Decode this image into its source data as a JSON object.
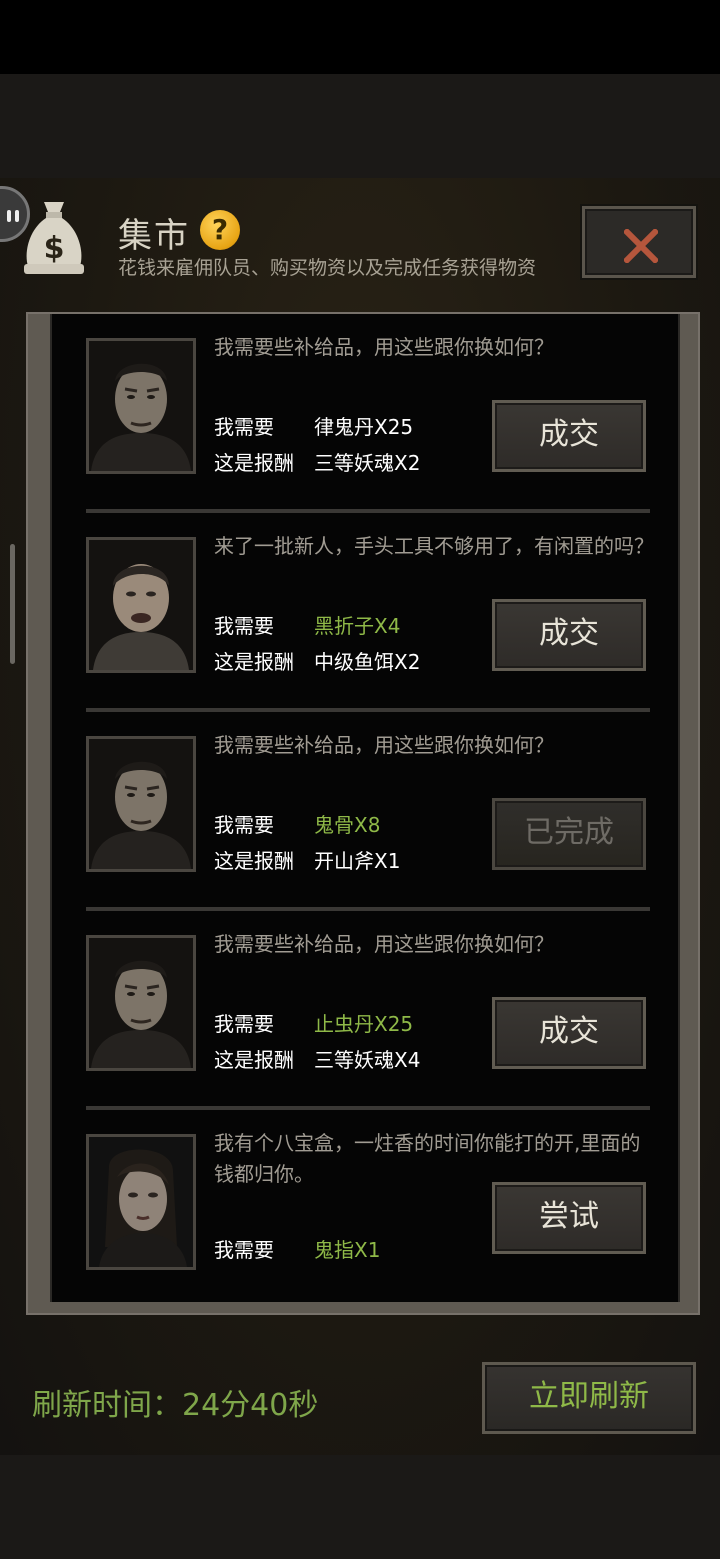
{
  "header": {
    "title": "集市",
    "help_symbol": "?",
    "subtitle": "花钱来雇佣队员、购买物资以及完成任务获得物资"
  },
  "colors": {
    "accent_green": "#8fb948",
    "panel_bg": "#1d1911",
    "close_x": "#b5563c"
  },
  "icons": {
    "header": "money-bag-icon",
    "close": "close-icon",
    "help": "help-icon"
  },
  "trades": [
    {
      "portrait": "man-1",
      "dialog": "我需要些补给品，用这些跟你换如何？",
      "need_label": "我需要",
      "need_item": "律鬼丹X25",
      "need_green": false,
      "reward_label": "这是报酬",
      "reward_item": "三等妖魂X2",
      "button": "成交",
      "completed": false
    },
    {
      "portrait": "man-2",
      "dialog": "来了一批新人，手头工具不够用了，有闲置的吗？",
      "need_label": "我需要",
      "need_item": "黑折子X4",
      "need_green": true,
      "reward_label": "这是报酬",
      "reward_item": "中级鱼饵X2",
      "button": "成交",
      "completed": false
    },
    {
      "portrait": "man-1",
      "dialog": "我需要些补给品，用这些跟你换如何？",
      "need_label": "我需要",
      "need_item": "鬼骨X8",
      "need_green": true,
      "reward_label": "这是报酬",
      "reward_item": "开山斧X1",
      "button": "已完成",
      "completed": true
    },
    {
      "portrait": "man-1",
      "dialog": "我需要些补给品，用这些跟你换如何？",
      "need_label": "我需要",
      "need_item": "止虫丹X25",
      "need_green": true,
      "reward_label": "这是报酬",
      "reward_item": "三等妖魂X4",
      "button": "成交",
      "completed": false
    },
    {
      "portrait": "woman-1",
      "dialog": "我有个八宝盒，一炷香的时间你能打的开,里面的钱都归你。",
      "need_label": "我需要",
      "need_item": "鬼指X1",
      "need_green": true,
      "reward_label": "",
      "reward_item": "",
      "button": "尝试",
      "completed": false
    }
  ],
  "footer": {
    "refresh_label": "刷新时间：",
    "refresh_time": "24分40秒",
    "refresh_button": "立即刷新"
  }
}
